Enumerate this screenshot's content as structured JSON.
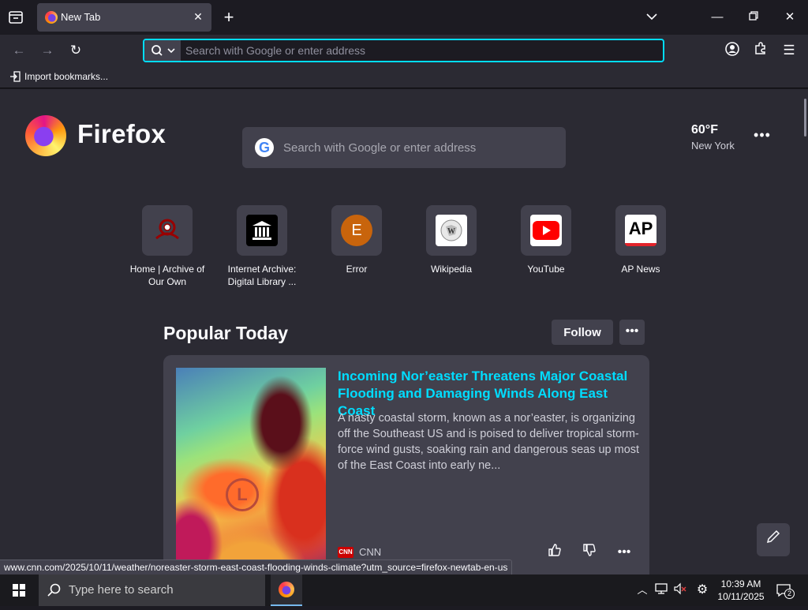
{
  "browser": {
    "tab_title": "New Tab",
    "url_placeholder": "Search with Google or enter address",
    "bookmark_import": "Import bookmarks..."
  },
  "newtab": {
    "brand": "Firefox",
    "search_placeholder": "Search with Google or enter address",
    "weather": {
      "temp": "60°F",
      "city": "New York"
    },
    "shortcuts": [
      {
        "label": "Home | Archive of Our Own",
        "icon": "ao3-icon",
        "color": "#990000"
      },
      {
        "label": "Internet Archive: Digital Library ...",
        "icon": "archive-icon",
        "color": "#000000"
      },
      {
        "label": "Error",
        "icon": "letter-e-icon",
        "letter": "E",
        "color": "#c8640c"
      },
      {
        "label": "Wikipedia",
        "icon": "wikipedia-icon",
        "color": "#ffffff"
      },
      {
        "label": "YouTube",
        "icon": "youtube-icon",
        "color": "#ff0000"
      },
      {
        "label": "AP News",
        "icon": "ap-icon",
        "letter": "AP",
        "color": "#ffffff"
      }
    ],
    "section": {
      "title": "Popular Today",
      "follow": "Follow"
    },
    "card": {
      "headline": "Incoming Nor’easter Threatens Major Coastal Flooding and Damaging Winds Along East Coast",
      "excerpt": "A nasty coastal storm, known as a nor’easter, is organizing off the Southeast US and is poised to deliver tropical storm-force wind gusts, soaking rain and dangerous seas up most of the East Coast into early ne...",
      "source": "CNN",
      "map_letter": "L",
      "source_logo": "CNN"
    },
    "status_url": "www.cnn.com/2025/10/11/weather/noreaster-storm-east-coast-flooding-winds-climate?utm_source=firefox-newtab-en-us"
  },
  "taskbar": {
    "search_placeholder": "Type here to search",
    "time": "10:39 AM",
    "date": "10/11/2025",
    "notification_count": "2"
  }
}
